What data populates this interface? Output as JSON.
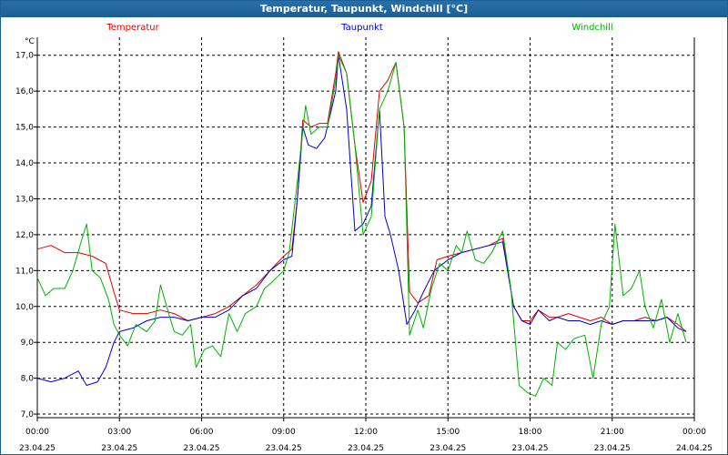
{
  "window": {
    "title": "Temperatur, Taupunkt, Windchill [°C]"
  },
  "chart_data": {
    "type": "line",
    "title": "Temperatur, Taupunkt, Windchill [°C]",
    "ylabel": "°C",
    "ylim": [
      6.9,
      17.5
    ],
    "xlim": [
      0,
      24
    ],
    "yticks": [
      7.0,
      8.0,
      9.0,
      10.0,
      11.0,
      12.0,
      13.0,
      14.0,
      15.0,
      16.0,
      17.0
    ],
    "ytick_labels": [
      "7,0",
      "8,0",
      "9,0",
      "10,0",
      "11,0",
      "12,0",
      "13,0",
      "14,0",
      "15,0",
      "16,0",
      "17,0"
    ],
    "xticks": [
      0,
      3,
      6,
      9,
      12,
      15,
      18,
      21,
      24
    ],
    "xtick_time_labels": [
      "00:00",
      "03:00",
      "06:00",
      "09:00",
      "12:00",
      "15:00",
      "18:00",
      "21:00",
      "00:00"
    ],
    "xtick_date_labels": [
      "23.04.25",
      "23.04.25",
      "23.04.25",
      "23.04.25",
      "23.04.25",
      "23.04.25",
      "23.04.25",
      "23.04.25",
      "24.04.25"
    ],
    "grid": true,
    "legend_position": "top",
    "series": [
      {
        "name": "Temperatur",
        "color": "#e00000",
        "points": [
          [
            0,
            11.6
          ],
          [
            0.5,
            11.7
          ],
          [
            1,
            11.5
          ],
          [
            1.5,
            11.5
          ],
          [
            2,
            11.4
          ],
          [
            2.5,
            11.2
          ],
          [
            2.8,
            10.4
          ],
          [
            3,
            9.9
          ],
          [
            3.5,
            9.8
          ],
          [
            4,
            9.8
          ],
          [
            4.5,
            9.9
          ],
          [
            5,
            9.8
          ],
          [
            5.5,
            9.6
          ],
          [
            6,
            9.7
          ],
          [
            6.5,
            9.8
          ],
          [
            7,
            10.0
          ],
          [
            7.5,
            10.3
          ],
          [
            8,
            10.6
          ],
          [
            8.5,
            11.0
          ],
          [
            9,
            11.4
          ],
          [
            9.3,
            11.6
          ],
          [
            9.5,
            13.0
          ],
          [
            9.7,
            15.2
          ],
          [
            10,
            15.0
          ],
          [
            10.3,
            15.1
          ],
          [
            10.6,
            15.1
          ],
          [
            10.9,
            16.5
          ],
          [
            11,
            17.1
          ],
          [
            11.3,
            16.5
          ],
          [
            11.6,
            14.5
          ],
          [
            11.9,
            12.9
          ],
          [
            12.2,
            13.5
          ],
          [
            12.5,
            16.0
          ],
          [
            12.8,
            16.3
          ],
          [
            13.1,
            16.8
          ],
          [
            13.4,
            15.0
          ],
          [
            13.6,
            10.4
          ],
          [
            13.9,
            10.1
          ],
          [
            14.3,
            10.3
          ],
          [
            14.6,
            11.3
          ],
          [
            15,
            11.4
          ],
          [
            15.5,
            11.5
          ],
          [
            16,
            11.6
          ],
          [
            16.5,
            11.7
          ],
          [
            17,
            11.9
          ],
          [
            17.4,
            10.0
          ],
          [
            17.7,
            9.6
          ],
          [
            18,
            9.6
          ],
          [
            18.3,
            9.9
          ],
          [
            18.7,
            9.7
          ],
          [
            19,
            9.7
          ],
          [
            19.4,
            9.8
          ],
          [
            19.8,
            9.7
          ],
          [
            20.2,
            9.6
          ],
          [
            20.6,
            9.7
          ],
          [
            21,
            9.5
          ],
          [
            21.4,
            9.6
          ],
          [
            21.8,
            9.6
          ],
          [
            22.2,
            9.7
          ],
          [
            22.6,
            9.6
          ],
          [
            23,
            9.7
          ],
          [
            23.4,
            9.5
          ],
          [
            23.7,
            9.3
          ]
        ]
      },
      {
        "name": "Taupunkt",
        "color": "#0000cc",
        "points": [
          [
            0,
            8.0
          ],
          [
            0.5,
            7.9
          ],
          [
            1,
            8.0
          ],
          [
            1.5,
            8.2
          ],
          [
            1.8,
            7.8
          ],
          [
            2.2,
            7.9
          ],
          [
            2.5,
            8.3
          ],
          [
            2.8,
            9.0
          ],
          [
            3,
            9.3
          ],
          [
            3.5,
            9.4
          ],
          [
            4,
            9.6
          ],
          [
            4.5,
            9.7
          ],
          [
            5,
            9.7
          ],
          [
            5.5,
            9.6
          ],
          [
            6,
            9.7
          ],
          [
            6.5,
            9.7
          ],
          [
            7,
            9.9
          ],
          [
            7.5,
            10.3
          ],
          [
            8,
            10.5
          ],
          [
            8.5,
            11.0
          ],
          [
            9,
            11.3
          ],
          [
            9.3,
            11.4
          ],
          [
            9.5,
            13.0
          ],
          [
            9.7,
            15.0
          ],
          [
            9.9,
            14.5
          ],
          [
            10.2,
            14.4
          ],
          [
            10.5,
            14.7
          ],
          [
            10.9,
            16.0
          ],
          [
            11,
            17.0
          ],
          [
            11.3,
            15.5
          ],
          [
            11.6,
            12.1
          ],
          [
            11.9,
            12.3
          ],
          [
            12.2,
            12.8
          ],
          [
            12.5,
            15.5
          ],
          [
            12.7,
            12.5
          ],
          [
            12.9,
            12.0
          ],
          [
            13.2,
            11.0
          ],
          [
            13.5,
            9.5
          ],
          [
            13.8,
            9.9
          ],
          [
            14.1,
            10.4
          ],
          [
            14.5,
            11.0
          ],
          [
            15,
            11.3
          ],
          [
            15.5,
            11.5
          ],
          [
            16,
            11.6
          ],
          [
            16.5,
            11.7
          ],
          [
            17,
            11.8
          ],
          [
            17.4,
            10.0
          ],
          [
            17.7,
            9.6
          ],
          [
            18,
            9.5
          ],
          [
            18.3,
            9.9
          ],
          [
            18.7,
            9.6
          ],
          [
            19,
            9.7
          ],
          [
            19.4,
            9.6
          ],
          [
            19.8,
            9.6
          ],
          [
            20.2,
            9.5
          ],
          [
            20.6,
            9.6
          ],
          [
            21,
            9.5
          ],
          [
            21.4,
            9.6
          ],
          [
            21.8,
            9.6
          ],
          [
            22.2,
            9.6
          ],
          [
            22.6,
            9.6
          ],
          [
            23,
            9.7
          ],
          [
            23.4,
            9.4
          ],
          [
            23.7,
            9.3
          ]
        ]
      },
      {
        "name": "Windchill",
        "color": "#00b000",
        "points": [
          [
            0,
            10.8
          ],
          [
            0.3,
            10.3
          ],
          [
            0.6,
            10.5
          ],
          [
            1,
            10.5
          ],
          [
            1.3,
            11.0
          ],
          [
            1.6,
            11.8
          ],
          [
            1.8,
            12.3
          ],
          [
            2.0,
            11.0
          ],
          [
            2.3,
            10.8
          ],
          [
            2.6,
            10.2
          ],
          [
            2.8,
            9.5
          ],
          [
            3,
            9.2
          ],
          [
            3.3,
            8.9
          ],
          [
            3.6,
            9.5
          ],
          [
            4,
            9.3
          ],
          [
            4.3,
            9.6
          ],
          [
            4.5,
            10.6
          ],
          [
            4.8,
            9.8
          ],
          [
            5,
            9.3
          ],
          [
            5.3,
            9.2
          ],
          [
            5.6,
            9.5
          ],
          [
            5.8,
            8.3
          ],
          [
            6.1,
            8.8
          ],
          [
            6.4,
            8.9
          ],
          [
            6.7,
            8.6
          ],
          [
            7,
            9.8
          ],
          [
            7.3,
            9.3
          ],
          [
            7.6,
            9.8
          ],
          [
            8,
            10.0
          ],
          [
            8.3,
            10.5
          ],
          [
            8.6,
            10.7
          ],
          [
            9,
            11.0
          ],
          [
            9.2,
            11.5
          ],
          [
            9.5,
            13.5
          ],
          [
            9.8,
            15.6
          ],
          [
            10,
            14.8
          ],
          [
            10.3,
            15.0
          ],
          [
            10.6,
            15.0
          ],
          [
            10.9,
            16.3
          ],
          [
            11,
            17.0
          ],
          [
            11.3,
            16.5
          ],
          [
            11.6,
            14.5
          ],
          [
            11.9,
            12.0
          ],
          [
            12.2,
            12.5
          ],
          [
            12.5,
            15.5
          ],
          [
            12.8,
            16.0
          ],
          [
            13.1,
            16.8
          ],
          [
            13.4,
            15.0
          ],
          [
            13.6,
            9.2
          ],
          [
            13.9,
            9.9
          ],
          [
            14.1,
            9.4
          ],
          [
            14.4,
            10.5
          ],
          [
            14.7,
            11.2
          ],
          [
            15,
            11.0
          ],
          [
            15.3,
            11.7
          ],
          [
            15.5,
            11.5
          ],
          [
            15.7,
            12.1
          ],
          [
            16,
            11.3
          ],
          [
            16.3,
            11.2
          ],
          [
            16.6,
            11.5
          ],
          [
            17,
            12.1
          ],
          [
            17.3,
            10.5
          ],
          [
            17.6,
            7.8
          ],
          [
            17.9,
            7.6
          ],
          [
            18.2,
            7.5
          ],
          [
            18.5,
            8.0
          ],
          [
            18.8,
            7.8
          ],
          [
            19,
            9.0
          ],
          [
            19.3,
            8.8
          ],
          [
            19.6,
            9.1
          ],
          [
            20,
            9.2
          ],
          [
            20.3,
            8.0
          ],
          [
            20.6,
            9.5
          ],
          [
            20.9,
            10.0
          ],
          [
            21.1,
            12.3
          ],
          [
            21.4,
            10.3
          ],
          [
            21.7,
            10.5
          ],
          [
            22,
            11.0
          ],
          [
            22.2,
            10.0
          ],
          [
            22.5,
            9.4
          ],
          [
            22.8,
            10.2
          ],
          [
            23.1,
            9.0
          ],
          [
            23.4,
            9.8
          ],
          [
            23.7,
            9.0
          ]
        ]
      }
    ]
  }
}
